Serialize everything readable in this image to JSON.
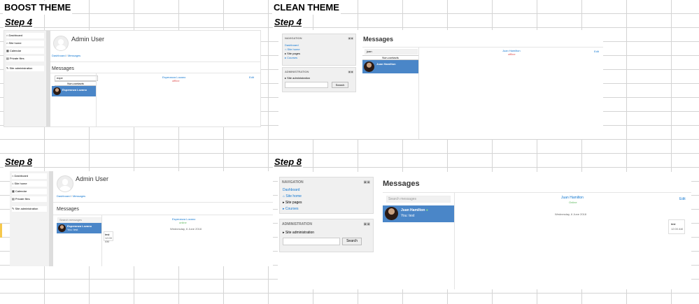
{
  "headers": {
    "boost": "BOOST THEME",
    "clean": "CLEAN THEME"
  },
  "steps": {
    "step4": "Step 4",
    "step8": "Step 8"
  },
  "boost": {
    "sidebar": [
      "Dashboard",
      "Site home",
      "Calendar",
      "Private files"
    ],
    "site_admin": "Site administration",
    "user_name": "Admin User",
    "breadcrumb": {
      "dashboard": "Dashboard",
      "sep": "/",
      "messages": "Messages"
    },
    "messages_title": "Messages",
    "step4": {
      "search_value": "expe",
      "section": "Non-contacts",
      "contact": "Esperanza Lozano",
      "panel_name": "Esperanza Lozano",
      "panel_status": "offline",
      "edit": "Edit"
    },
    "step8": {
      "search_placeholder": "Search messages",
      "contact": "Esperanza Lozano",
      "contact_preview": "You: test",
      "panel_name": "Esperanza Lozano",
      "panel_status": "online",
      "date": "Wednesday, 6 June 2018",
      "bubble_text": "test",
      "bubble_time": "12:00 AM"
    }
  },
  "clean": {
    "navigation": {
      "title": "NAVIGATION",
      "dashboard": "Dashboard",
      "items": [
        "Site home",
        "Site pages",
        "Courses"
      ]
    },
    "administration": {
      "title": "ADMINISTRATION",
      "item": "Site administration",
      "search_button": "Search"
    },
    "messages_title": "Messages",
    "step4": {
      "search_value": "juan",
      "section": "Non-contacts",
      "contact": "Juan Hamilton",
      "panel_name": "Juan Hamilton",
      "panel_status": "offline",
      "edit": "Edit"
    },
    "step8": {
      "search_placeholder": "Search messages",
      "contact": "Juan Hamilton",
      "contact_preview": "You: test",
      "panel_name": "Juan Hamilton",
      "panel_status": "Online",
      "edit": "Edit",
      "date": "Wednesday, 6 June 2018",
      "bubble_text": "test",
      "bubble_time": "12:00 AM"
    }
  },
  "colors": {
    "selected": "#4a86c8",
    "link": "#1177d1",
    "offline": "#e05050",
    "online": "#5cb85c"
  }
}
